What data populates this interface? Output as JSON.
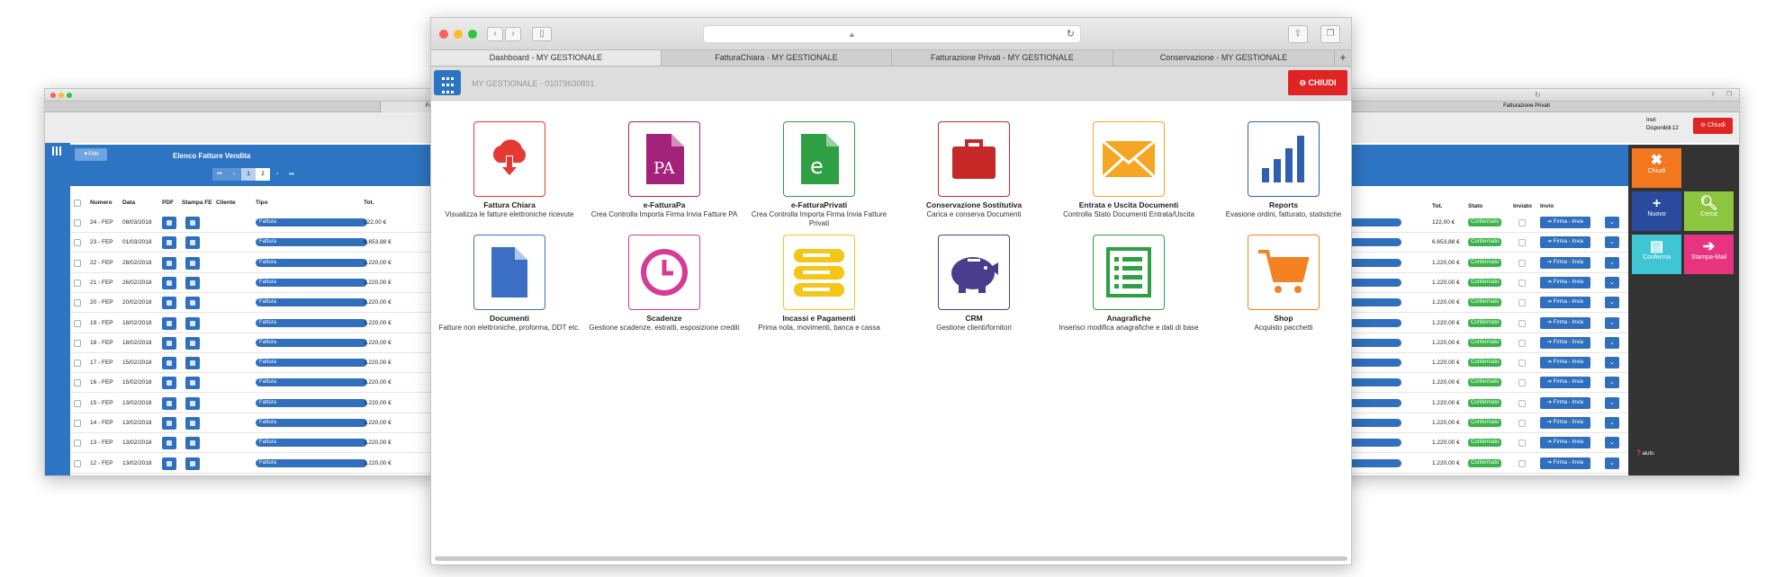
{
  "left_window": {
    "toolbar_title": "Filtri",
    "list_title": "Elenco Fatture Vendita",
    "tab_partial": "Fa",
    "pages": [
      "1",
      "2"
    ],
    "columns": [
      "Numero",
      "Data",
      "PDF",
      "Stampa FE",
      "Cliente",
      "Tipo",
      "Tot."
    ],
    "rows": [
      {
        "num": "24 - FEP",
        "date": "08/03/2018",
        "tipo": "Fattura",
        "tot": "122,00 €"
      },
      {
        "num": "23 - FEP",
        "date": "01/03/2018",
        "tipo": "Fattura",
        "tot": "6.653,88 €"
      },
      {
        "num": "22 - FEP",
        "date": "28/02/2018",
        "tipo": "Fattura",
        "tot": "1.220,00 €"
      },
      {
        "num": "21 - FEP",
        "date": "26/02/2018",
        "tipo": "Fattura",
        "tot": "1.220,00 €"
      },
      {
        "num": "20 - FEP",
        "date": "20/02/2018",
        "tipo": "Fattura",
        "tot": "1.220,00 €"
      },
      {
        "num": "19 - FEP",
        "date": "18/02/2018",
        "tipo": "Fattura",
        "tot": "1.220,00 €"
      },
      {
        "num": "18 - FEP",
        "date": "18/02/2018",
        "tipo": "Fattura",
        "tot": "1.220,00 €"
      },
      {
        "num": "17 - FEP",
        "date": "15/02/2018",
        "tipo": "Fattura",
        "tot": "1.220,00 €"
      },
      {
        "num": "16 - FEP",
        "date": "15/02/2018",
        "tipo": "Fattura",
        "tot": "1.220,00 €"
      },
      {
        "num": "15 - FEP",
        "date": "13/02/2018",
        "tipo": "Fattura",
        "tot": "1.220,00 €"
      },
      {
        "num": "14 - FEP",
        "date": "13/02/2018",
        "tipo": "Fattura",
        "tot": "1.220,00 €"
      },
      {
        "num": "13 - FEP",
        "date": "13/02/2018",
        "tipo": "Fattura",
        "tot": "1.220,00 €"
      },
      {
        "num": "12 - FEP",
        "date": "13/02/2018",
        "tipo": "Fattura",
        "tot": "1.220,00 €"
      }
    ]
  },
  "right_window": {
    "tab_title": "Fatturazione Privati",
    "invii_label": "Invii",
    "disponibili": "Disponibili:12",
    "chiudi_small": "Chiudi",
    "columns": [
      "Tot.",
      "Stato",
      "Inviato",
      "Invio"
    ],
    "stato": "Confermato",
    "firma": "Firma - Invia",
    "totals": [
      "122,00 €",
      "6.653,88 €",
      "1.220,00 €",
      "1.220,00 €",
      "1.220,00 €",
      "1.220,00 €",
      "1.220,00 €",
      "1.220,00 €",
      "1.220,00 €",
      "1.220,00 €",
      "1.220,00 €",
      "1.220,00 €",
      "1.220,00 €"
    ],
    "side": {
      "chiudi": "Chiudi",
      "nuovo": "Nuovo",
      "cerca": "Cerca",
      "conferma": "Conferma",
      "stampa": "Stampa-Mail",
      "aiuto": "aiuto"
    }
  },
  "main_window": {
    "tabs": [
      "Dashboard - MY GESTIONALE",
      "FatturaChiara - MY GESTIONALE",
      "Fatturazione Privati - MY GESTIONALE",
      "Conservazione - MY GESTIONALE"
    ],
    "new_tab": "+",
    "app_title": "MY GESTIONALE - 01079630891",
    "close_button": "CHIUDI",
    "modules": [
      {
        "title": "Fattura Chiara",
        "desc": "Visualizza le fatture elettroniche ricevute",
        "color": "#e53935",
        "icon": "cloud-download-icon"
      },
      {
        "title": "e-FatturaPa",
        "desc": "Crea Controlla Importa Firma Invia Fatture PA",
        "color": "#a3237b",
        "icon": "document-pa-icon"
      },
      {
        "title": "e-FatturaPrivati",
        "desc": "Crea Controlla Importa Firma Invia Fatture Privati",
        "color": "#2ea043",
        "icon": "document-e-icon"
      },
      {
        "title": "Conservazione Sostitutiva",
        "desc": "Carica e conserva Documenti",
        "color": "#c62828",
        "icon": "briefcase-icon"
      },
      {
        "title": "Entrata e Uscita Documenti",
        "desc": "Controlla Stato Documenti Entrata/Uscita",
        "color": "#f5a623",
        "icon": "envelope-icon"
      },
      {
        "title": "Reports",
        "desc": "Evasione ordini, fatturato, statistiche",
        "color": "#2f5fb3",
        "icon": "bar-chart-icon"
      },
      {
        "title": "Documenti",
        "desc": "Fatture non elettroniche, proforma, DDT etc.",
        "color": "#3a6fc4",
        "icon": "document-icon"
      },
      {
        "title": "Scadenze",
        "desc": "Gestione scadenze, estratti, esposizione crediti",
        "color": "#d63c96",
        "icon": "clock-icon"
      },
      {
        "title": "Incassi e Pagamenti",
        "desc": "Prima nota, movimenti, banca e cassa",
        "color": "#f5c518",
        "icon": "database-icon"
      },
      {
        "title": "CRM",
        "desc": "Gestione clienti/fornitori",
        "color": "#4a3c8c",
        "icon": "piggy-bank-icon"
      },
      {
        "title": "Anagrafiche",
        "desc": "Inserisci modifica anagrafiche e dati di base",
        "color": "#2ea043",
        "icon": "list-icon"
      },
      {
        "title": "Shop",
        "desc": "Acquisto pacchetti",
        "color": "#f58220",
        "icon": "cart-icon"
      }
    ]
  }
}
